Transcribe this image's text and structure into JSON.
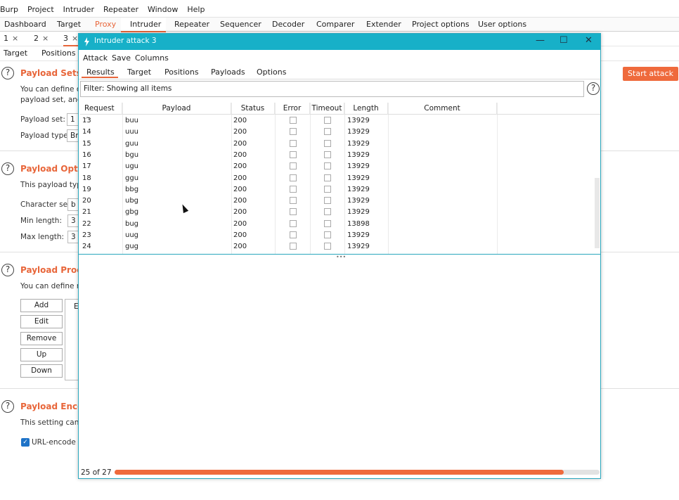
{
  "main": {
    "menu": [
      "Burp",
      "Project",
      "Intruder",
      "Repeater",
      "Window",
      "Help"
    ],
    "tabs": [
      "Dashboard",
      "Target",
      "Proxy",
      "Intruder",
      "Repeater",
      "Sequencer",
      "Decoder",
      "Comparer",
      "Extender",
      "Project options",
      "User options"
    ],
    "active_tab": "Intruder",
    "attack_tabs": [
      "1",
      "2",
      "3"
    ],
    "close_glyph": "×",
    "subtabs": [
      "Target",
      "Positions"
    ],
    "start_attack": "Start attack",
    "sections": {
      "payload_sets": {
        "title": "Payload Sets",
        "text1": "You can define o",
        "text2": "payload set, and",
        "set_label": "Payload set:",
        "set_value": "1",
        "type_label": "Payload type:",
        "type_value": "Br"
      },
      "payload_options": {
        "title": "Payload Option",
        "text": "This payload type",
        "charset_label": "Character set:",
        "charset_value": "b",
        "min_label": "Min length:",
        "min_value": "3",
        "max_label": "Max length:",
        "max_value": "3"
      },
      "payload_processing": {
        "title": "Payload Proces",
        "text": "You can define ru",
        "buttons": [
          "Add",
          "Edit",
          "Remove",
          "Up",
          "Down"
        ],
        "list_text": "E"
      },
      "payload_encoding": {
        "title": "Payload Encodi",
        "text": "This setting can b",
        "checkbox_label": "URL-encode th",
        "checkbox_checked": true
      }
    }
  },
  "attack_window": {
    "title": "Intruder attack 3",
    "controls": [
      "—",
      "☐",
      "✕"
    ],
    "menu": [
      "Attack",
      "Save",
      "Columns"
    ],
    "tabs": [
      "Results",
      "Target",
      "Positions",
      "Payloads",
      "Options"
    ],
    "active_tab": "Results",
    "filter": "Filter: Showing all items",
    "columns": [
      "Request",
      "Payload",
      "Status",
      "Error",
      "Timeout",
      "Length",
      "Comment"
    ],
    "sort_glyph": "^",
    "rows": [
      {
        "request": "13",
        "payload": "buu",
        "status": "200",
        "error": false,
        "timeout": false,
        "length": "13929"
      },
      {
        "request": "14",
        "payload": "uuu",
        "status": "200",
        "error": false,
        "timeout": false,
        "length": "13929"
      },
      {
        "request": "15",
        "payload": "guu",
        "status": "200",
        "error": false,
        "timeout": false,
        "length": "13929"
      },
      {
        "request": "16",
        "payload": "bgu",
        "status": "200",
        "error": false,
        "timeout": false,
        "length": "13929"
      },
      {
        "request": "17",
        "payload": "ugu",
        "status": "200",
        "error": false,
        "timeout": false,
        "length": "13929"
      },
      {
        "request": "18",
        "payload": "ggu",
        "status": "200",
        "error": false,
        "timeout": false,
        "length": "13929"
      },
      {
        "request": "19",
        "payload": "bbg",
        "status": "200",
        "error": false,
        "timeout": false,
        "length": "13929"
      },
      {
        "request": "20",
        "payload": "ubg",
        "status": "200",
        "error": false,
        "timeout": false,
        "length": "13929"
      },
      {
        "request": "21",
        "payload": "gbg",
        "status": "200",
        "error": false,
        "timeout": false,
        "length": "13929"
      },
      {
        "request": "22",
        "payload": "bug",
        "status": "200",
        "error": false,
        "timeout": false,
        "length": "13898"
      },
      {
        "request": "23",
        "payload": "uug",
        "status": "200",
        "error": false,
        "timeout": false,
        "length": "13929"
      },
      {
        "request": "24",
        "payload": "gug",
        "status": "200",
        "error": false,
        "timeout": false,
        "length": "13929"
      }
    ],
    "progress_text": "25 of 27",
    "progress_fraction": 0.926
  },
  "colors": {
    "accent": "#e8663a",
    "titlebar": "#17b0c8",
    "start_button": "#ef6a3c"
  }
}
